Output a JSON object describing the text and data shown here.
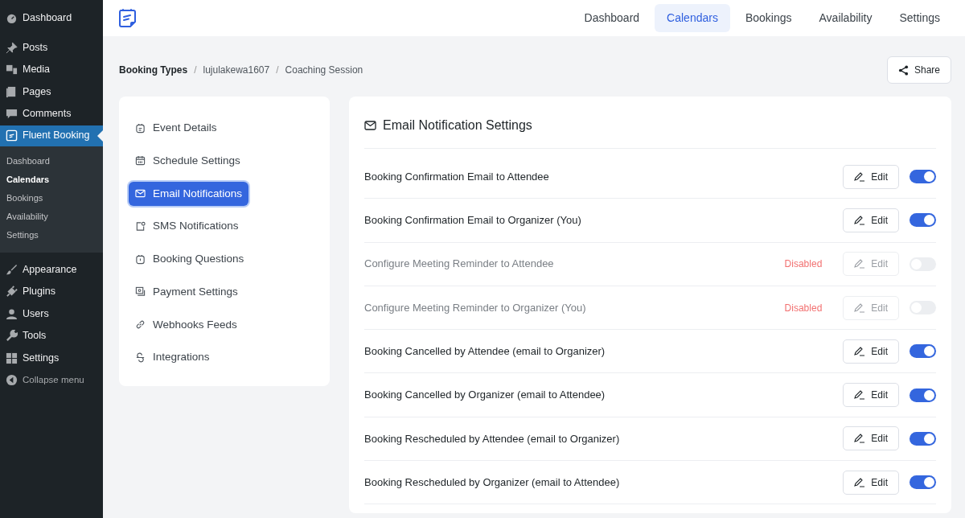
{
  "admin_menu": {
    "items": [
      {
        "label": "Dashboard",
        "kind": "gauge",
        "selected": false
      },
      {
        "label": "Posts",
        "kind": "pin",
        "selected": false
      },
      {
        "label": "Media",
        "kind": "media",
        "selected": false
      },
      {
        "label": "Pages",
        "kind": "pages",
        "selected": false
      },
      {
        "label": "Comments",
        "kind": "comment",
        "selected": false
      },
      {
        "label": "Fluent Booking",
        "kind": "logo",
        "selected": true,
        "children": [
          {
            "label": "Dashboard",
            "selected": false
          },
          {
            "label": "Calendars",
            "selected": true
          },
          {
            "label": "Bookings",
            "selected": false
          },
          {
            "label": "Availability",
            "selected": false
          },
          {
            "label": "Settings",
            "selected": false
          }
        ]
      },
      {
        "label": "Appearance",
        "kind": "brush",
        "selected": false
      },
      {
        "label": "Plugins",
        "kind": "plug",
        "selected": false
      },
      {
        "label": "Users",
        "kind": "user",
        "selected": false
      },
      {
        "label": "Tools",
        "kind": "wrench",
        "selected": false
      },
      {
        "label": "Settings",
        "kind": "grid",
        "selected": false
      }
    ],
    "collapse": "Collapse menu"
  },
  "top_nav": [
    {
      "label": "Dashboard",
      "selected": false
    },
    {
      "label": "Calendars",
      "selected": true
    },
    {
      "label": "Bookings",
      "selected": false
    },
    {
      "label": "Availability",
      "selected": false
    },
    {
      "label": "Settings",
      "selected": false
    }
  ],
  "breadcrumb": [
    {
      "kind": "link",
      "text": "Booking Types"
    },
    {
      "kind": "separator",
      "text": "/"
    },
    {
      "kind": "link",
      "text": "lujulakewa1607"
    },
    {
      "kind": "separator",
      "text": "/"
    },
    {
      "kind": "link",
      "text": "Coaching Session"
    }
  ],
  "share_button": "Share",
  "settings_nav": [
    {
      "label": "Event Details",
      "kind": "details",
      "selected": false
    },
    {
      "label": "Schedule Settings",
      "kind": "calendar",
      "selected": false
    },
    {
      "label": "Email Notifications",
      "kind": "mail",
      "selected": true
    },
    {
      "label": "SMS Notifications",
      "kind": "sms",
      "selected": false
    },
    {
      "label": "Booking Questions",
      "kind": "question",
      "selected": false
    },
    {
      "label": "Payment Settings",
      "kind": "payment",
      "selected": false
    },
    {
      "label": "Webhooks Feeds",
      "kind": "link",
      "selected": false
    },
    {
      "label": "Integrations",
      "kind": "integrations",
      "selected": false
    }
  ],
  "panel": {
    "title": "Email Notification Settings",
    "rows": [
      {
        "label": "Booking Confirmation Email to Attendee",
        "on": true,
        "edit": "Edit"
      },
      {
        "label": "Booking Confirmation Email to Organizer (You)",
        "on": true,
        "edit": "Edit"
      },
      {
        "label": "Configure Meeting Reminder to Attendee",
        "on": false,
        "status": "Disabled",
        "edit": "Edit"
      },
      {
        "label": "Configure Meeting Reminder to Organizer (You)",
        "on": false,
        "status": "Disabled",
        "edit": "Edit"
      },
      {
        "label": "Booking Cancelled by Attendee (email to Organizer)",
        "on": true,
        "edit": "Edit"
      },
      {
        "label": "Booking Cancelled by Organizer (email to Attendee)",
        "on": true,
        "edit": "Edit"
      },
      {
        "label": "Booking Rescheduled by Attendee (email to Organizer)",
        "on": true,
        "edit": "Edit"
      },
      {
        "label": "Booking Rescheduled by Organizer (email to Attendee)",
        "on": true,
        "edit": "Edit"
      }
    ]
  }
}
